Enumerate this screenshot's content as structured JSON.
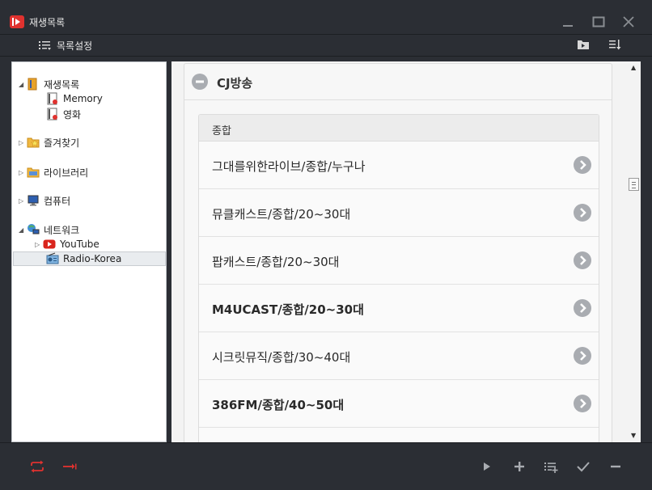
{
  "window": {
    "title": "재생목록"
  },
  "toolbar": {
    "settings_label": "목록설정"
  },
  "tree": {
    "items": [
      {
        "label": "재생목록",
        "expanded": true
      },
      {
        "label": "Memory"
      },
      {
        "label": "영화"
      },
      {
        "label": "즐겨찾기",
        "expanded": false
      },
      {
        "label": "라이브러리",
        "expanded": false
      },
      {
        "label": "컴퓨터",
        "expanded": false
      },
      {
        "label": "네트워크",
        "expanded": true
      },
      {
        "label": "YouTube",
        "expanded": false
      },
      {
        "label": "Radio-Korea",
        "selected": true
      }
    ]
  },
  "content": {
    "section_title": "CJ방송",
    "group_title": "종합",
    "stations": [
      {
        "label": "그대를위한라이브/종합/누구나"
      },
      {
        "label": "뮤클캐스트/종합/20~30대"
      },
      {
        "label": "팝캐스트/종합/20~30대"
      },
      {
        "label": "M4UCAST/종합/20~30대"
      },
      {
        "label": "시크릿뮤직/종합/30~40대"
      },
      {
        "label": "386FM/종합/40~50대"
      },
      {
        "label": ""
      }
    ]
  },
  "colors": {
    "accent": "#e0322f",
    "chrome": "#2b2e34",
    "icon_gray": "#a9acb1"
  },
  "icons": {
    "bottom_left": [
      "repeat-icon",
      "sequential-icon"
    ],
    "bottom_right": [
      "play-icon",
      "add-icon",
      "add-to-list-icon",
      "check-icon",
      "remove-icon"
    ]
  }
}
